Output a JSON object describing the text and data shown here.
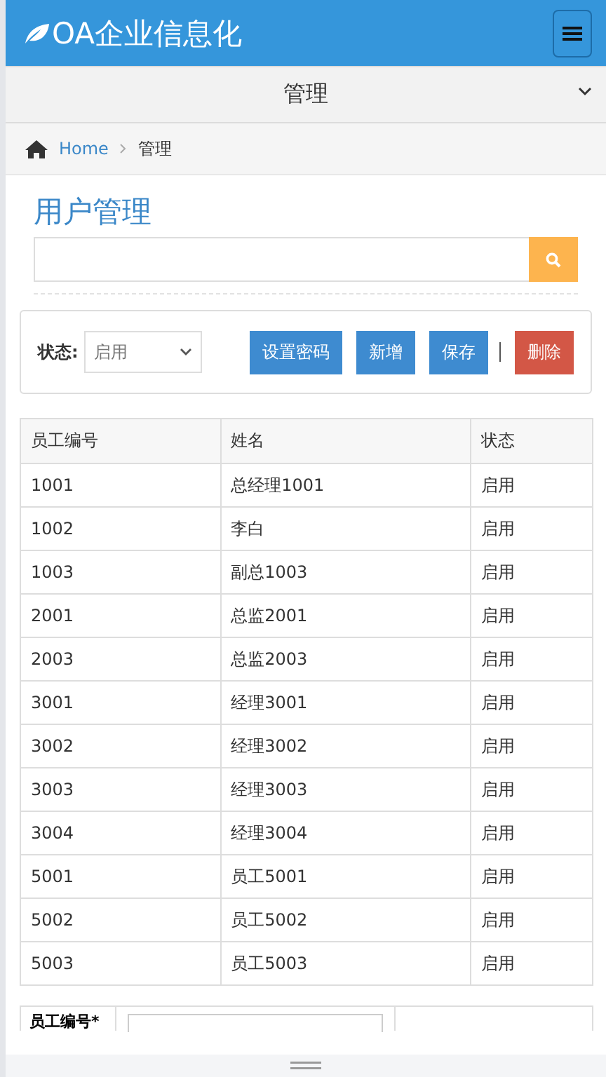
{
  "header": {
    "brand": "OA企业信息化"
  },
  "nav": {
    "title": "管理"
  },
  "breadcrumb": [
    {
      "label": "Home",
      "kind": "link"
    },
    {
      "label": "管理",
      "kind": "current"
    }
  ],
  "page_title": "用户管理",
  "toolbar": {
    "status_label": "状态:",
    "status_value": "启用",
    "buttons": [
      {
        "label": "设置密码",
        "kind": "primary"
      },
      {
        "label": "新增",
        "kind": "primary"
      },
      {
        "label": "保存",
        "kind": "primary"
      },
      {
        "label": "删除",
        "kind": "danger"
      }
    ]
  },
  "table": {
    "columns": [
      "员工编号",
      "姓名",
      "状态"
    ],
    "rows": [
      [
        "1001",
        "总经理1001",
        "启用"
      ],
      [
        "1002",
        "李白",
        "启用"
      ],
      [
        "1003",
        "副总1003",
        "启用"
      ],
      [
        "2001",
        "总监2001",
        "启用"
      ],
      [
        "2003",
        "总监2003",
        "启用"
      ],
      [
        "3001",
        "经理3001",
        "启用"
      ],
      [
        "3002",
        "经理3002",
        "启用"
      ],
      [
        "3003",
        "经理3003",
        "启用"
      ],
      [
        "3004",
        "经理3004",
        "启用"
      ],
      [
        "5001",
        "员工5001",
        "启用"
      ],
      [
        "5002",
        "员工5002",
        "启用"
      ],
      [
        "5003",
        "员工5003",
        "启用"
      ]
    ]
  },
  "form": {
    "label": "员工编号*"
  }
}
